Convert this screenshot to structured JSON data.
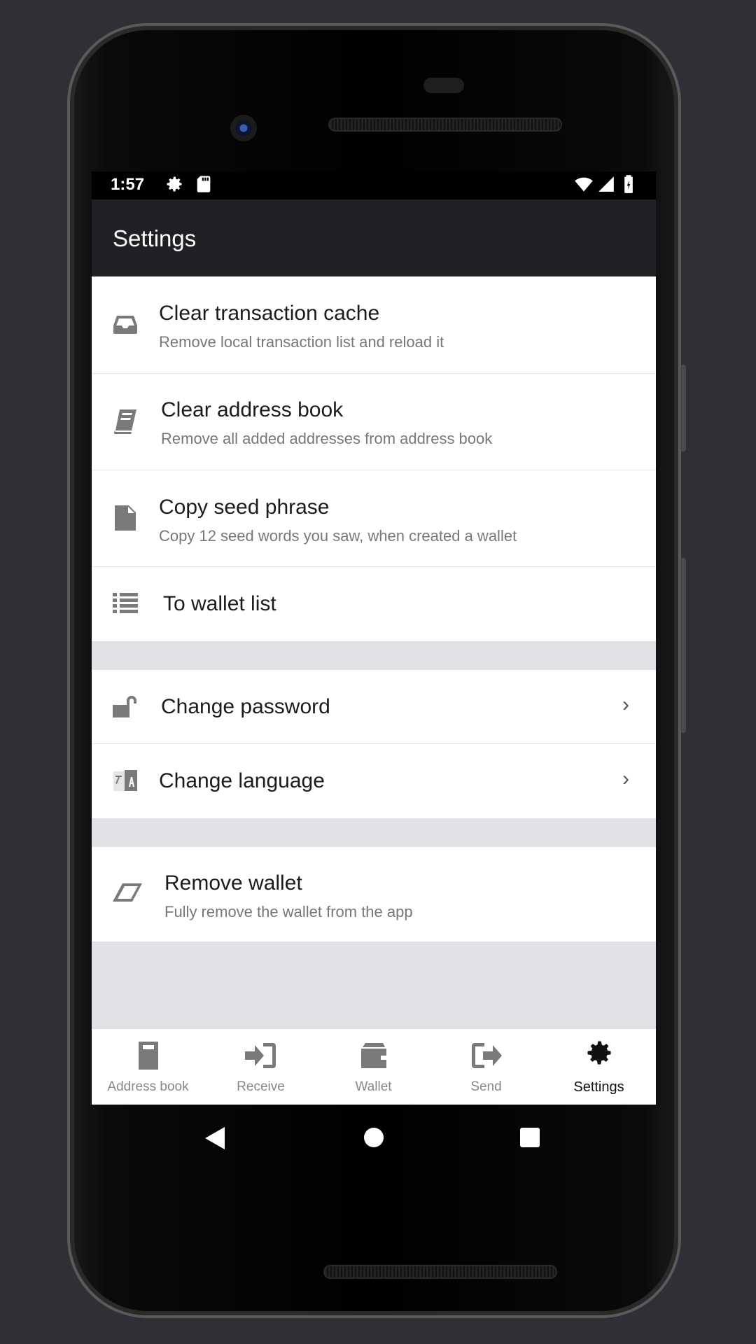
{
  "status_bar": {
    "time": "1:57"
  },
  "app_bar": {
    "title": "Settings"
  },
  "settings": {
    "clear_cache": {
      "label": "Clear transaction cache",
      "sub": "Remove local transaction list and reload it",
      "icon": "inbox-icon"
    },
    "clear_address_book": {
      "label": "Clear address book",
      "sub": "Remove all added addresses from address book",
      "icon": "book-icon"
    },
    "copy_seed": {
      "label": "Copy seed phrase",
      "sub": "Copy 12 seed words you saw, when created a wallet",
      "icon": "document-icon"
    },
    "wallet_list": {
      "label": "To wallet list",
      "icon": "list-icon"
    },
    "change_password": {
      "label": "Change password",
      "icon": "unlock-icon"
    },
    "change_language": {
      "label": "Change language",
      "icon": "translate-icon"
    },
    "remove_wallet": {
      "label": "Remove wallet",
      "sub": "Fully remove the wallet from the app",
      "icon": "eraser-icon"
    }
  },
  "tabs": [
    {
      "label": "Address book",
      "icon": "address-book-icon",
      "active": false
    },
    {
      "label": "Receive",
      "icon": "receive-icon",
      "active": false
    },
    {
      "label": "Wallet",
      "icon": "wallet-icon",
      "active": false
    },
    {
      "label": "Send",
      "icon": "send-icon",
      "active": false
    },
    {
      "label": "Settings",
      "icon": "gear-icon",
      "active": true
    }
  ],
  "colors": {
    "background": "#2e3035",
    "app_bar": "#1f2024",
    "section_gap": "#e0e2e6",
    "icon_gray": "#7a7a7a",
    "active_tab": "#111111"
  }
}
